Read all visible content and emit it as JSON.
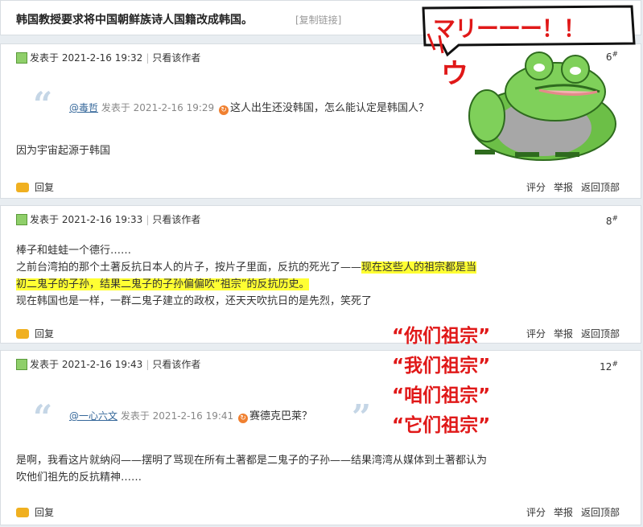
{
  "thread": {
    "title": "韩国教授要求将中国朝鲜族诗人国籍改成韩国。",
    "copy_link": "[复制链接]"
  },
  "sticker": {
    "bubble_text": "マリーーー！！",
    "sound_text": "ウ"
  },
  "posts": [
    {
      "posted_at": "发表于 2021-2-16 19:32",
      "only_author": "只看该作者",
      "floor": "6",
      "quote": {
        "user": "@毒哲",
        "posted_at": "发表于 2021-2-16 19:29",
        "text": "这人出生还没韩国，怎么能认定是韩国人？"
      },
      "lines": [
        "因为宇宙起源于韩国"
      ]
    },
    {
      "posted_at": "发表于 2021-2-16 19:33",
      "only_author": "只看该作者",
      "floor": "8",
      "line1": "棒子和蛙蛙一个德行……",
      "line2_plain": "之前台湾拍的那个土著反抗日本人的片子，按片子里面，反抗的死光了——",
      "line2_hl": "现在这些人的祖宗都是当",
      "line3_hl": "初二鬼子的子孙，结果二鬼子的子孙偏偏吹“祖宗”的反抗历史。",
      "line4": "现在韩国也是一样，一群二鬼子建立的政权，还天天吹抗日的是先烈，笑死了"
    },
    {
      "posted_at": "发表于 2021-2-16 19:43",
      "only_author": "只看该作者",
      "floor": "12",
      "quote": {
        "user": "@一心六文",
        "posted_at": "发表于 2021-2-16 19:41",
        "text": "赛德克巴莱？"
      },
      "lines": [
        "是啊，我看这片就纳闷——摆明了骂现在所有土著都是二鬼子的子孙——结果湾湾从媒体到土著都认为",
        "吹他们祖先的反抗精神……"
      ]
    }
  ],
  "footer": {
    "reply": "回复",
    "rate": "评分",
    "report": "举报",
    "top": "返回顶部"
  },
  "overlay": [
    "“你们祖宗”",
    "“我们祖宗”",
    "“咱们祖宗”",
    "“它们祖宗”"
  ],
  "colors": {
    "highlight": "#ffff33",
    "overlay_red": "#e01818",
    "link": "#336699"
  }
}
